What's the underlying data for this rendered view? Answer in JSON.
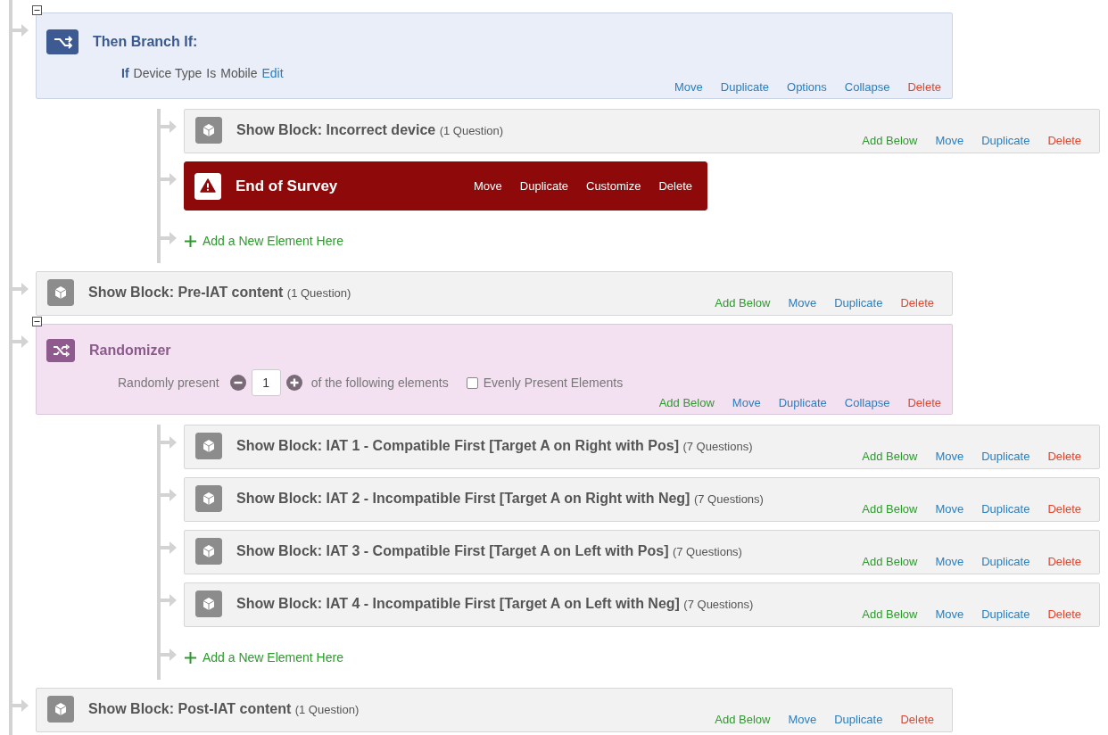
{
  "flow": [
    {
      "kind": "branch",
      "title": "Then Branch If:",
      "expanded": true,
      "condition": {
        "keyword": "If",
        "field": "Device Type",
        "operator": "Is",
        "value": "Mobile",
        "edit": "Edit"
      },
      "actions": [
        {
          "label": "Move",
          "kind": "normal"
        },
        {
          "label": "Duplicate",
          "kind": "normal"
        },
        {
          "label": "Options",
          "kind": "normal"
        },
        {
          "label": "Collapse",
          "kind": "normal"
        },
        {
          "label": "Delete",
          "kind": "delete"
        }
      ],
      "children": [
        {
          "kind": "block",
          "title": "Show Block: Incorrect device",
          "count": "(1 Question)",
          "actions": [
            {
              "label": "Add Below",
              "kind": "add"
            },
            {
              "label": "Move",
              "kind": "normal"
            },
            {
              "label": "Duplicate",
              "kind": "normal"
            },
            {
              "label": "Delete",
              "kind": "delete"
            }
          ]
        },
        {
          "kind": "end",
          "title": "End of Survey",
          "actions": [
            {
              "label": "Move",
              "kind": "normal"
            },
            {
              "label": "Duplicate",
              "kind": "normal"
            },
            {
              "label": "Customize",
              "kind": "normal"
            },
            {
              "label": "Delete",
              "kind": "delete"
            }
          ]
        },
        {
          "kind": "add",
          "label": "Add a New Element Here"
        }
      ]
    },
    {
      "kind": "block",
      "title": "Show Block: Pre-IAT content",
      "count": "(1 Question)",
      "actions": [
        {
          "label": "Add Below",
          "kind": "add"
        },
        {
          "label": "Move",
          "kind": "normal"
        },
        {
          "label": "Duplicate",
          "kind": "normal"
        },
        {
          "label": "Delete",
          "kind": "delete"
        }
      ]
    },
    {
      "kind": "randomizer",
      "title": "Randomizer",
      "expanded": true,
      "prefix": "Randomly present",
      "count": "1",
      "suffix": "of the following elements",
      "evenly": {
        "label": "Evenly Present Elements",
        "checked": false
      },
      "actions": [
        {
          "label": "Add Below",
          "kind": "add"
        },
        {
          "label": "Move",
          "kind": "normal"
        },
        {
          "label": "Duplicate",
          "kind": "normal"
        },
        {
          "label": "Collapse",
          "kind": "normal"
        },
        {
          "label": "Delete",
          "kind": "delete"
        }
      ],
      "children": [
        {
          "kind": "block",
          "title": "Show Block: IAT 1 - Compatible First [Target A on Right with Pos]",
          "count": "(7 Questions)",
          "actions": [
            {
              "label": "Add Below",
              "kind": "add"
            },
            {
              "label": "Move",
              "kind": "normal"
            },
            {
              "label": "Duplicate",
              "kind": "normal"
            },
            {
              "label": "Delete",
              "kind": "delete"
            }
          ]
        },
        {
          "kind": "block",
          "title": "Show Block: IAT 2 - Incompatible First [Target A on Right with Neg]",
          "count": "(7 Questions)",
          "actions": [
            {
              "label": "Add Below",
              "kind": "add"
            },
            {
              "label": "Move",
              "kind": "normal"
            },
            {
              "label": "Duplicate",
              "kind": "normal"
            },
            {
              "label": "Delete",
              "kind": "delete"
            }
          ]
        },
        {
          "kind": "block",
          "title": "Show Block: IAT 3 - Compatible First [Target A on Left with Pos]",
          "count": "(7 Questions)",
          "actions": [
            {
              "label": "Add Below",
              "kind": "add"
            },
            {
              "label": "Move",
              "kind": "normal"
            },
            {
              "label": "Duplicate",
              "kind": "normal"
            },
            {
              "label": "Delete",
              "kind": "delete"
            }
          ]
        },
        {
          "kind": "block",
          "title": "Show Block: IAT 4 - Incompatible First [Target A on Left with Neg]",
          "count": "(7 Questions)",
          "actions": [
            {
              "label": "Add Below",
              "kind": "add"
            },
            {
              "label": "Move",
              "kind": "normal"
            },
            {
              "label": "Duplicate",
              "kind": "normal"
            },
            {
              "label": "Delete",
              "kind": "delete"
            }
          ]
        },
        {
          "kind": "add",
          "label": "Add a New Element Here"
        }
      ]
    },
    {
      "kind": "block",
      "title": "Show Block: Post-IAT content",
      "count": "(1 Question)",
      "actions": [
        {
          "label": "Add Below",
          "kind": "add"
        },
        {
          "label": "Move",
          "kind": "normal"
        },
        {
          "label": "Duplicate",
          "kind": "normal"
        },
        {
          "label": "Delete",
          "kind": "delete"
        }
      ]
    }
  ]
}
